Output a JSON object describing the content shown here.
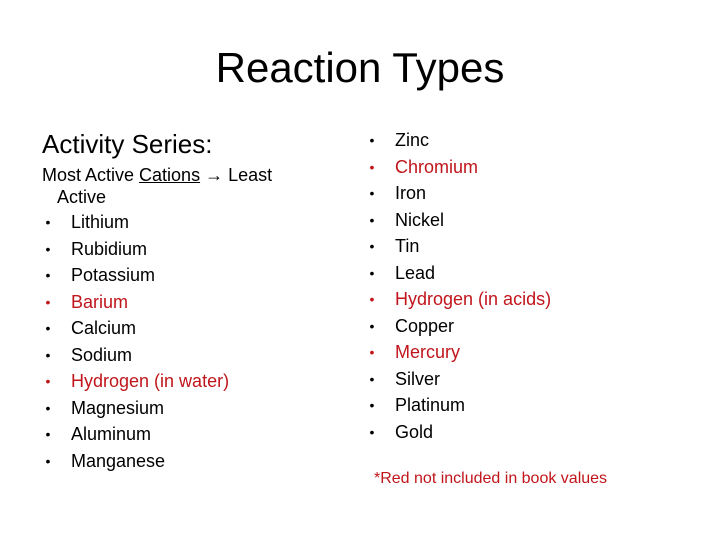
{
  "title": "Reaction Types",
  "left": {
    "heading": "Activity Series:",
    "subhead": {
      "prefix": "Most Active ",
      "underlined": "Cations",
      "arrow": "→",
      "suffix": " Least",
      "continuation": "Active"
    },
    "items": [
      {
        "label": "Lithium",
        "highlight": false
      },
      {
        "label": "Rubidium",
        "highlight": false
      },
      {
        "label": "Potassium",
        "highlight": false
      },
      {
        "label": "Barium",
        "highlight": true
      },
      {
        "label": "Calcium",
        "highlight": false
      },
      {
        "label": "Sodium",
        "highlight": false
      },
      {
        "label": "Hydrogen (in water)",
        "highlight": true
      },
      {
        "label": "Magnesium",
        "highlight": false
      },
      {
        "label": "Aluminum",
        "highlight": false
      },
      {
        "label": "Manganese",
        "highlight": false
      }
    ]
  },
  "right": {
    "items": [
      {
        "label": "Zinc",
        "highlight": false
      },
      {
        "label": "Chromium",
        "highlight": true
      },
      {
        "label": "Iron",
        "highlight": false
      },
      {
        "label": "Nickel",
        "highlight": false
      },
      {
        "label": "Tin",
        "highlight": false
      },
      {
        "label": "Lead",
        "highlight": false
      },
      {
        "label": "Hydrogen (in acids)",
        "highlight": true
      },
      {
        "label": "Copper",
        "highlight": false
      },
      {
        "label": "Mercury",
        "highlight": true
      },
      {
        "label": "Silver",
        "highlight": false
      },
      {
        "label": "Platinum",
        "highlight": false
      },
      {
        "label": "Gold",
        "highlight": false
      }
    ]
  },
  "note": "*Red not included in book values",
  "bullet_glyph": "•",
  "colors": {
    "text": "#000000",
    "highlight": "#c0151b",
    "background": "#ffffff"
  }
}
